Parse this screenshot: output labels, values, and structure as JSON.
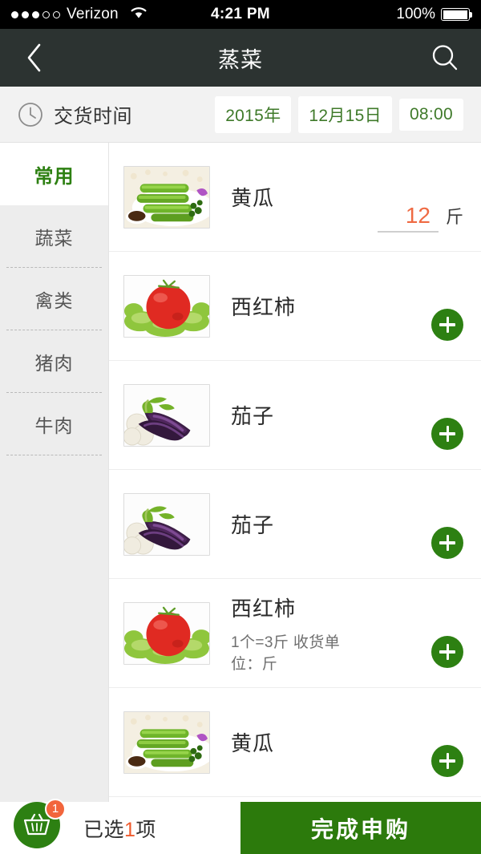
{
  "status_bar": {
    "carrier": "Verizon",
    "time": "4:21 PM",
    "battery": "100%",
    "signal_dots_filled": 3,
    "signal_dots_total": 5
  },
  "nav": {
    "title": "蒸菜",
    "back_icon": "chevron-left-icon",
    "search_icon": "search-icon"
  },
  "delivery": {
    "icon": "clock-icon",
    "label": "交货时间",
    "year": "2015年",
    "date": "12月15日",
    "time": "08:00"
  },
  "sidebar": {
    "items": [
      {
        "label": "常用",
        "active": true
      },
      {
        "label": "蔬菜",
        "active": false
      },
      {
        "label": "禽类",
        "active": false
      },
      {
        "label": "猪肉",
        "active": false
      },
      {
        "label": "牛肉",
        "active": false
      }
    ]
  },
  "list": {
    "items": [
      {
        "name": "黄瓜",
        "sub": "",
        "image": "cucumber",
        "qty": "12",
        "unit": "斤",
        "has_qty": true
      },
      {
        "name": "西红柿",
        "sub": "",
        "image": "tomato",
        "qty": "",
        "unit": "",
        "has_qty": false
      },
      {
        "name": "茄子",
        "sub": "",
        "image": "eggplant",
        "qty": "",
        "unit": "",
        "has_qty": false
      },
      {
        "name": "茄子",
        "sub": "",
        "image": "eggplant",
        "qty": "",
        "unit": "",
        "has_qty": false
      },
      {
        "name": "西红柿",
        "sub": "1个=3斤  收货单位：斤",
        "image": "tomato",
        "qty": "",
        "unit": "",
        "has_qty": false
      },
      {
        "name": "黄瓜",
        "sub": "",
        "image": "cucumber",
        "qty": "",
        "unit": "",
        "has_qty": false
      }
    ],
    "add_icon": "plus-icon"
  },
  "bottom": {
    "basket_icon": "shopping-basket-icon",
    "badge_count": "1",
    "selected_prefix": "已选",
    "selected_count": "1",
    "selected_suffix": "项",
    "submit_label": "完成申购"
  },
  "colors": {
    "brand_green": "#2d8012",
    "submit_green": "#2c7a0c",
    "accent_orange": "#ef6a43",
    "navbar": "#2c3331",
    "pill_text": "#3f7a2a"
  }
}
